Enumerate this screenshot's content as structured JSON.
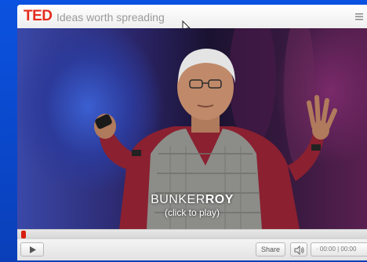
{
  "header": {
    "brand": "TED",
    "tagline": "Ideas worth spreading"
  },
  "video": {
    "caption_first": "BUNKER",
    "caption_last": "ROY",
    "caption_hint": "(click to play)"
  },
  "progress": {
    "played_fraction": 0.0
  },
  "controls": {
    "share_label": "Share",
    "time_text": "· 00:00 | 00:00"
  },
  "colors": {
    "brand_red": "#e62b1e",
    "background_blue": "#0a47c9",
    "progress_handle": "#d81e10"
  },
  "icons": {
    "play": "play-icon",
    "volume": "volume-icon",
    "menu": "menu-icon",
    "cursor": "cursor-icon"
  }
}
